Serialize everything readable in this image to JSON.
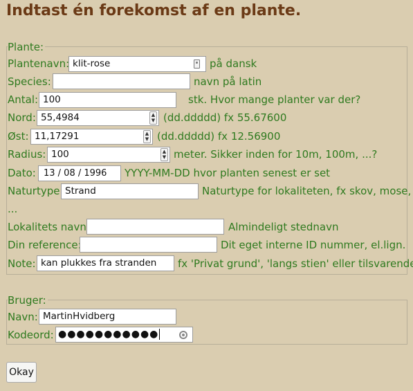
{
  "page": {
    "title": "Indtast én forekomst af en plante."
  },
  "plante": {
    "legend": "Plante:",
    "plantenavn": {
      "label": "Plantenavn:",
      "value": "klit-rose",
      "hint": "på dansk"
    },
    "species": {
      "label": "Species:",
      "value": "",
      "hint": "navn på latin"
    },
    "antal": {
      "label": "Antal:",
      "value": "100",
      "hint": "stk. Hvor mange planter var der?"
    },
    "nord": {
      "label": "Nord:",
      "value": "55,4984",
      "hint": "(dd.ddddd) fx 55.67600"
    },
    "oest": {
      "label": "Øst:",
      "value": "11,17291",
      "hint": "(dd.ddddd) fx 12.56900"
    },
    "radius": {
      "label": "Radius:",
      "value": "100",
      "hint": "meter. Sikker inden for 10m, 100m, ...?"
    },
    "dato": {
      "label": "Dato:",
      "value": "13 / 08 / 1996",
      "hint": "YYYY-MM-DD hvor planten senest er set"
    },
    "naturtype": {
      "label": "Naturtype:",
      "value": "Strand",
      "hint": "Naturtype for lokaliteten, fx skov, mose,",
      "hint2": "..."
    },
    "lokalitet": {
      "label": "Lokalitets navn:",
      "value": "",
      "hint": "Almindeligt stednavn"
    },
    "reference": {
      "label": "Din reference:",
      "value": "",
      "hint": "Dit eget interne ID nummer, el.lign."
    },
    "note": {
      "label": "Note:",
      "value": "kan plukkes fra stranden",
      "hint": "fx 'Privat grund', 'langs stien' eller tilsvarende"
    }
  },
  "bruger": {
    "legend": "Bruger:",
    "navn": {
      "label": "Navn:",
      "value": "MartinHvidberg"
    },
    "kodeord": {
      "label": "Kodeord:",
      "value": "●●●●●●●●●●●"
    }
  },
  "submit": {
    "label": "Okay"
  },
  "colors": {
    "background": "#dacdb0",
    "title": "#6b3a16",
    "label": "#2f7a1f"
  },
  "icons": {
    "plantenavn_field": "contact-card-icon",
    "kodeord_field": "password-reveal-icon",
    "number_fields": "spinner-arrows-icon"
  }
}
